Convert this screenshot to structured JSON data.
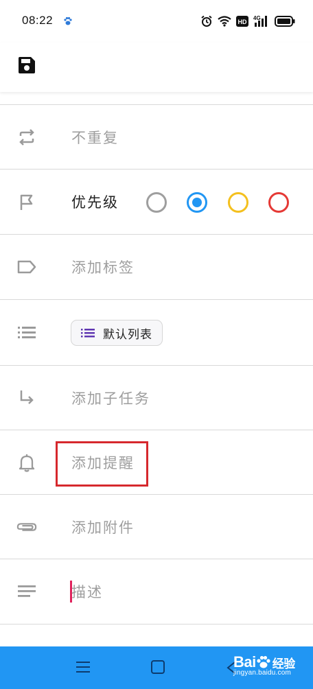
{
  "status_bar": {
    "time": "08:22",
    "icons": [
      "baidu-paw-icon",
      "alarm-icon",
      "wifi-icon",
      "hd-icon",
      "signal-4g-icon",
      "battery-icon"
    ],
    "hd_label": "HD",
    "network_label": "4G"
  },
  "toolbar": {
    "icons": [
      "save-icon"
    ]
  },
  "rows": {
    "repeat": {
      "icon": "repeat-icon",
      "label": "不重复"
    },
    "priority": {
      "icon": "flag-icon",
      "label": "优先级",
      "options": [
        {
          "color": "#9e9e9e",
          "selected": false
        },
        {
          "color": "#2196f3",
          "selected": true
        },
        {
          "color": "#f4c01e",
          "selected": false
        },
        {
          "color": "#e53935",
          "selected": false
        }
      ]
    },
    "tag": {
      "icon": "tag-icon",
      "label": "添加标签"
    },
    "list": {
      "icon": "list-icon",
      "chip_icon": "list-icon",
      "chip_label": "默认列表",
      "chip_icon_color": "#5e35b1"
    },
    "subtask": {
      "icon": "subtask-arrow-icon",
      "label": "添加子任务"
    },
    "reminder": {
      "icon": "bell-icon",
      "label": "添加提醒"
    },
    "attachment": {
      "icon": "paperclip-icon",
      "label": "添加附件"
    },
    "description": {
      "icon": "notes-icon",
      "placeholder": "描述"
    }
  },
  "nav_bar": {
    "color": "#2196f3",
    "icons": [
      "menu-icon",
      "home-square-icon",
      "back-triangle-icon"
    ]
  },
  "watermark": {
    "brand": "Bai",
    "brand_suffix": "经验",
    "url": "jingyan.baidu.com"
  },
  "highlight_color": "#d6282d"
}
